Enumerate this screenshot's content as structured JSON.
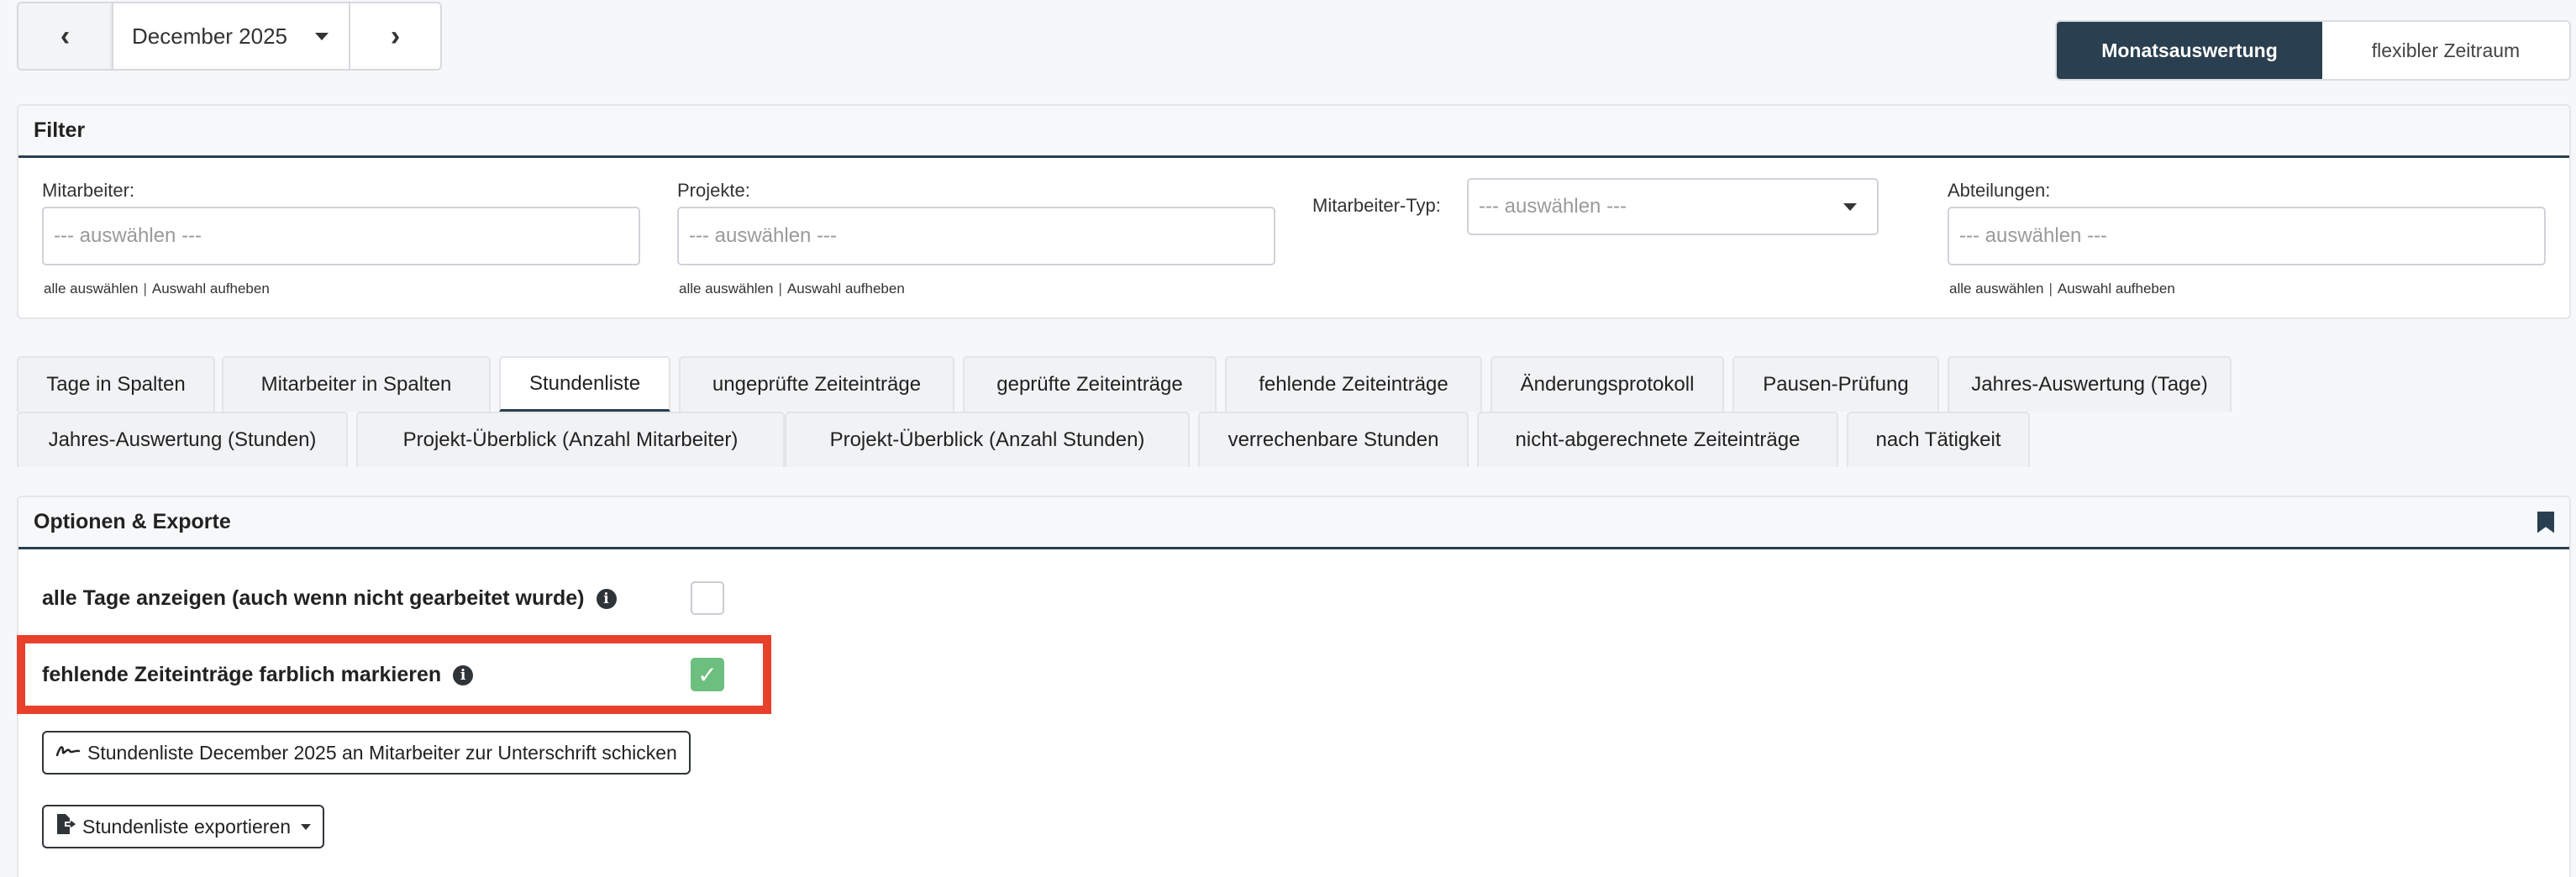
{
  "month_nav": {
    "prev_icon": "chevron-left-icon",
    "prev_glyph": "‹",
    "month": "December 2025",
    "next_icon": "chevron-right-icon",
    "next_glyph": "›"
  },
  "view_switch": {
    "active_label": "Monatsauswertung",
    "inactive_label": "flexibler Zeitraum"
  },
  "filter": {
    "title": "Filter",
    "select_all": "alle auswählen",
    "separator": "|",
    "clear": "Auswahl aufheben",
    "fields": [
      {
        "label": "Mitarbeiter:",
        "placeholder": "--- auswählen ---"
      },
      {
        "label": "Projekte:",
        "placeholder": "--- auswählen ---"
      },
      {
        "label": "Mitarbeiter-Typ:",
        "placeholder": "--- auswählen ---"
      },
      {
        "label": "Abteilungen:",
        "placeholder": "--- auswählen ---"
      }
    ]
  },
  "tabs": {
    "active_index": 2,
    "row1": [
      "Tage in Spalten",
      "Mitarbeiter in Spalten",
      "Stundenliste",
      "ungeprüfte Zeiteinträge",
      "geprüfte Zeiteinträge",
      "fehlende Zeiteinträge",
      "Änderungsprotokoll",
      "Pausen-Prüfung",
      "Jahres-Auswertung (Tage)"
    ],
    "row2": [
      "Jahres-Auswertung (Stunden)",
      "Projekt-Überblick (Anzahl Mitarbeiter)",
      "Projekt-Überblick (Anzahl Stunden)",
      "verrechenbare Stunden",
      "nicht-abgerechnete Zeiteinträge",
      "nach Tätigkeit"
    ]
  },
  "options": {
    "title": "Optionen & Exporte",
    "show_all_days": {
      "label": "alle Tage anzeigen (auch wenn nicht gearbeitet wurde)",
      "checked": false
    },
    "mark_missing": {
      "label": "fehlende Zeiteinträge farblich markieren",
      "checked": true
    },
    "info_glyph": "i",
    "check_glyph": "✓",
    "send_button": "Stundenliste December 2025 an Mitarbeiter zur Unterschrift schicken",
    "export_button": "Stundenliste exportieren",
    "highlight_color": "#e8412b"
  },
  "colors": {
    "accent": "#2a3f50",
    "check_green": "#6dbf7f"
  }
}
